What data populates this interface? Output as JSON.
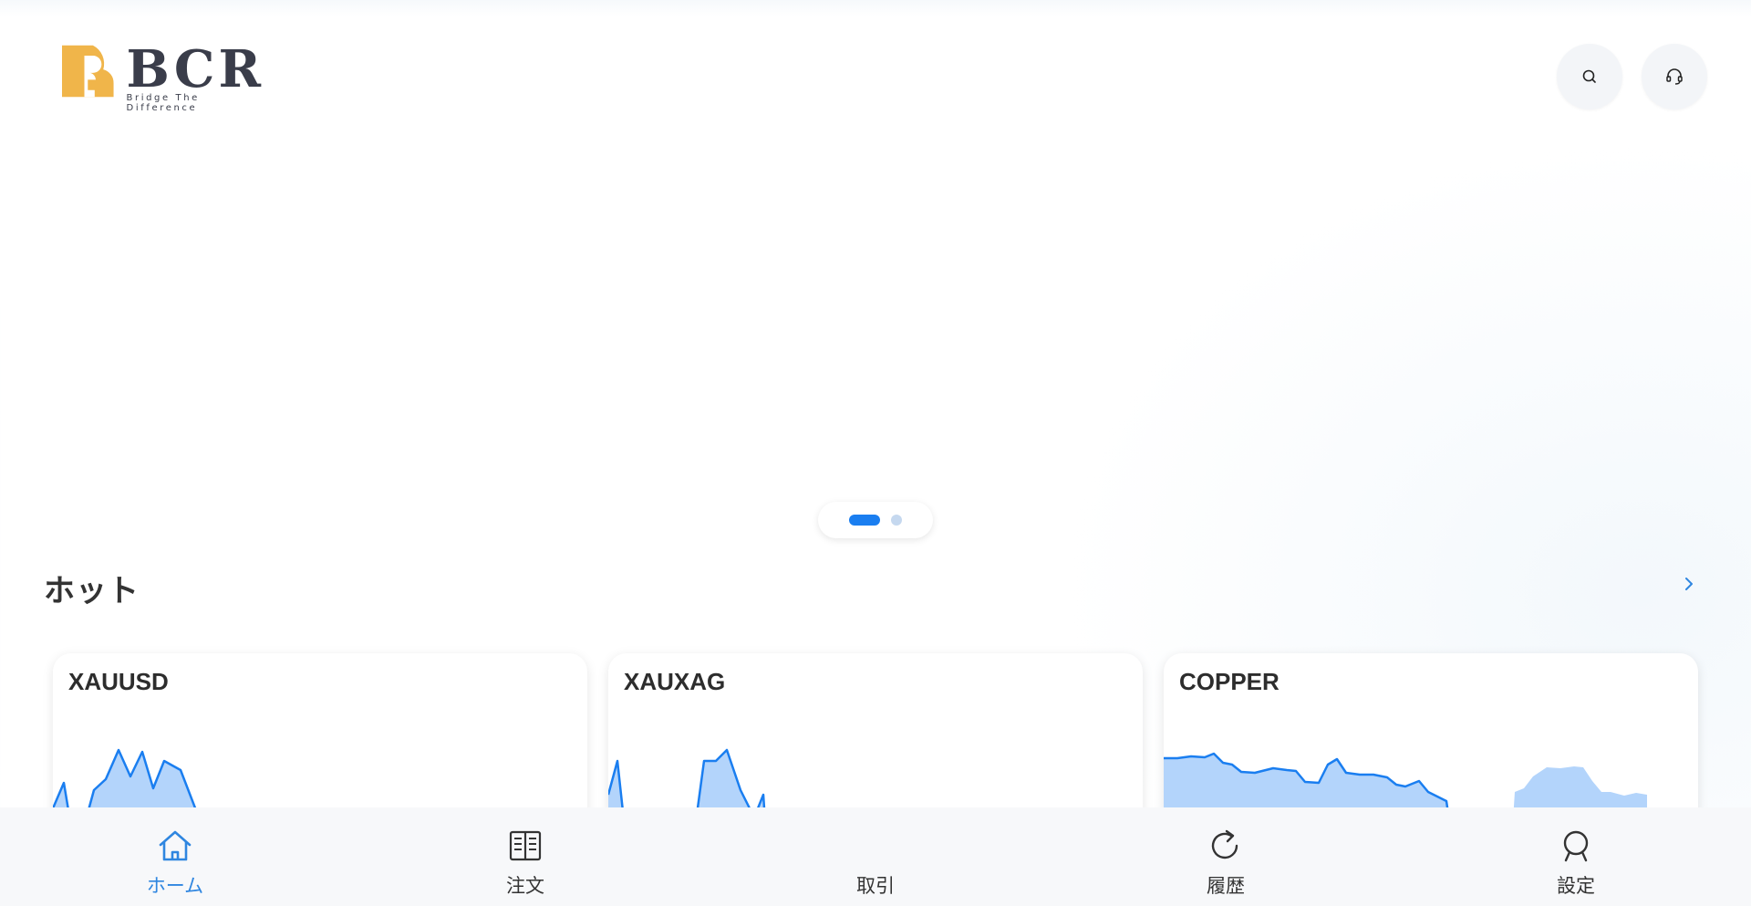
{
  "header": {
    "logo_text": "BCR",
    "logo_tagline": "Bridge The Difference",
    "colors": {
      "logo_mark": "#f0b54a",
      "logo_text": "#3a3d4a"
    },
    "icons": [
      "search-icon",
      "headset-icon"
    ]
  },
  "carousel": {
    "slides": 2,
    "active_index": 0,
    "colors": {
      "active": "#1a7ef0",
      "inactive": "#c5d8ef"
    }
  },
  "hot": {
    "title": "ホット",
    "more_icon": "chevron-right-icon",
    "cards": [
      {
        "symbol": "XAUUSD"
      },
      {
        "symbol": "XAUXAG"
      },
      {
        "symbol": "COPPER"
      }
    ],
    "colors": {
      "spark_line": "#1a7ef0",
      "spark_fill": "#b3d4fb"
    }
  },
  "nav": {
    "items": [
      {
        "label": "ホーム",
        "icon": "home-icon",
        "active": true
      },
      {
        "label": "注文",
        "icon": "book-icon",
        "active": false
      },
      {
        "label": "取引",
        "icon": "",
        "active": false
      },
      {
        "label": "履歴",
        "icon": "refresh-icon",
        "active": false
      },
      {
        "label": "設定",
        "icon": "user-icon",
        "active": false
      }
    ],
    "colors": {
      "active": "#2f86e0",
      "inactive": "#333333"
    }
  }
}
